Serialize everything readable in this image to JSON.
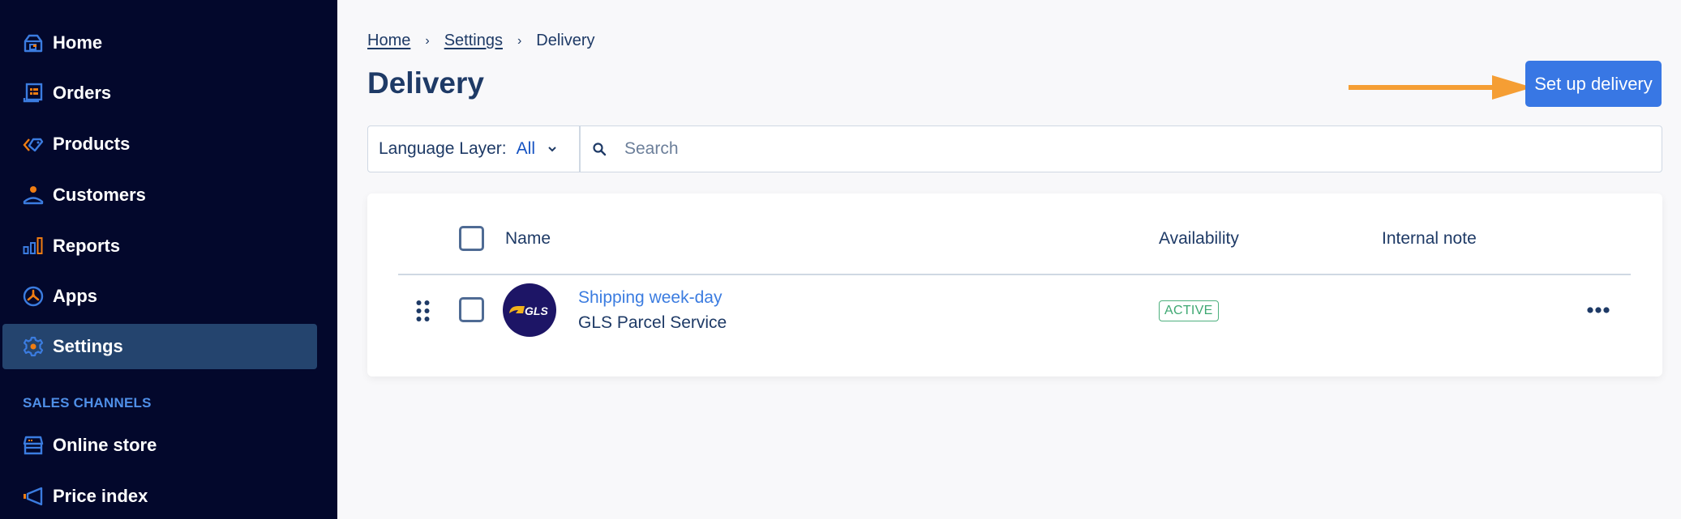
{
  "sidebar": {
    "items": [
      {
        "label": "Home",
        "icon": "home-icon"
      },
      {
        "label": "Orders",
        "icon": "orders-icon"
      },
      {
        "label": "Products",
        "icon": "tag-icon"
      },
      {
        "label": "Customers",
        "icon": "person-icon"
      },
      {
        "label": "Reports",
        "icon": "bar-chart-icon"
      },
      {
        "label": "Apps",
        "icon": "apps-icon"
      },
      {
        "label": "Settings",
        "icon": "gear-icon",
        "active": true
      }
    ],
    "section_label": "SALES CHANNELS",
    "channels": [
      {
        "label": "Online store",
        "icon": "store-icon"
      },
      {
        "label": "Price index",
        "icon": "megaphone-icon"
      }
    ]
  },
  "breadcrumb": {
    "items": [
      "Home",
      "Settings",
      "Delivery"
    ],
    "separator": "›"
  },
  "page": {
    "title": "Delivery",
    "primary_button": "Set up delivery"
  },
  "filters": {
    "language_label": "Language Layer:",
    "language_value": "All",
    "search_placeholder": "Search",
    "search_value": ""
  },
  "table": {
    "columns": [
      "Name",
      "Availability",
      "Internal note"
    ],
    "rows": [
      {
        "name": "Shipping week-day",
        "carrier": "GLS Parcel Service",
        "logo_text": "GLS",
        "availability": "ACTIVE",
        "internal_note": ""
      }
    ]
  },
  "colors": {
    "sidebar_bg": "#03082c",
    "sidebar_active": "#24446e",
    "accent_blue": "#3877e4",
    "icon_orange": "#f07d12",
    "annotation_arrow": "#f59e34",
    "active_green": "#3ea872"
  }
}
